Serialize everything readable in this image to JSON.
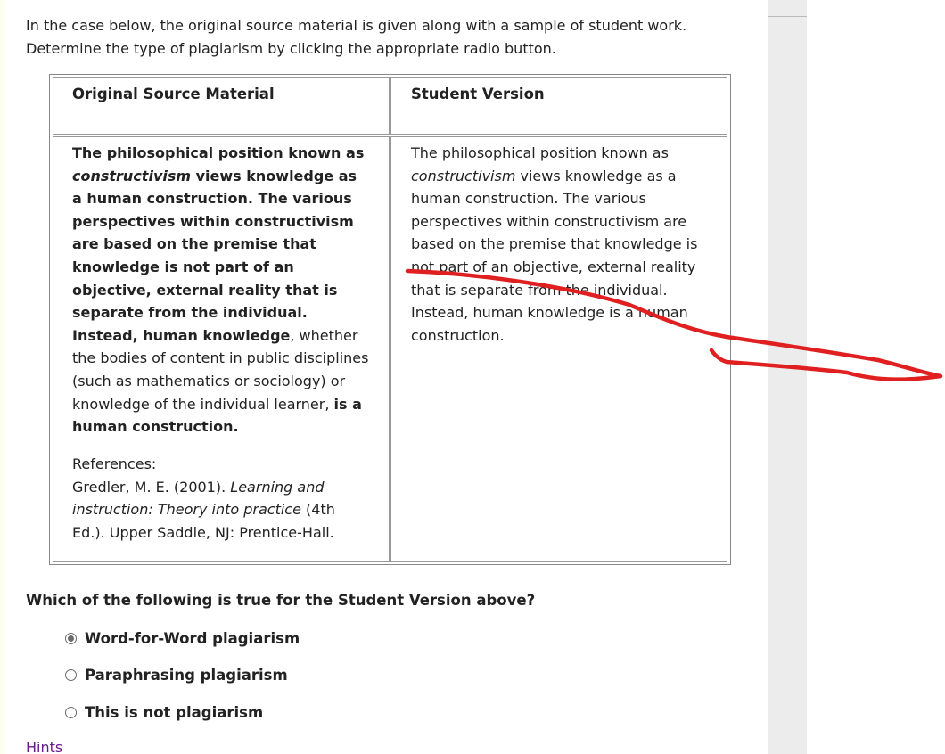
{
  "intro": {
    "line1": "In the case below, the original source material is given along with a sample of student work.",
    "line2": "Determine the type of plagiarism by clicking the appropriate radio button."
  },
  "table": {
    "original_header": "Original Source Material",
    "student_header": "Student Version",
    "original": {
      "lines": [
        {
          "segments": [
            {
              "text": "The philosophical position known as",
              "style": "bold"
            }
          ]
        },
        {
          "segments": [
            {
              "text": "constructivism",
              "style": "bold-italic"
            },
            {
              "text": " views knowledge as",
              "style": "bold"
            }
          ]
        },
        {
          "segments": [
            {
              "text": "a human construction. The various",
              "style": "bold"
            }
          ]
        },
        {
          "segments": [
            {
              "text": "perspectives within constructivism",
              "style": "bold"
            }
          ]
        },
        {
          "segments": [
            {
              "text": "are based on the premise that",
              "style": "bold"
            }
          ]
        },
        {
          "segments": [
            {
              "text": "knowledge is not part of an",
              "style": "bold"
            }
          ]
        },
        {
          "segments": [
            {
              "text": "objective, external reality that is",
              "style": "bold"
            }
          ]
        },
        {
          "segments": [
            {
              "text": "separate from the individual.",
              "style": "bold"
            }
          ]
        },
        {
          "segments": [
            {
              "text": "Instead, human knowledge",
              "style": "bold"
            },
            {
              "text": ", whether",
              "style": "normal"
            }
          ]
        },
        {
          "segments": [
            {
              "text": "the bodies of content in public disciplines",
              "style": "normal"
            }
          ]
        },
        {
          "segments": [
            {
              "text": "(such as mathematics or sociology) or",
              "style": "normal"
            }
          ]
        },
        {
          "segments": [
            {
              "text": "knowledge of the individual learner, ",
              "style": "normal"
            },
            {
              "text": "is a",
              "style": "bold"
            }
          ]
        },
        {
          "segments": [
            {
              "text": "human construction.",
              "style": "bold"
            }
          ]
        }
      ]
    },
    "references": {
      "label": "References:",
      "lines": [
        {
          "segments": [
            {
              "text": "Gredler, M. E. (2001). ",
              "style": "normal"
            },
            {
              "text": "Learning and",
              "style": "italic"
            }
          ]
        },
        {
          "segments": [
            {
              "text": "instruction: Theory into practice",
              "style": "italic"
            },
            {
              "text": " (4th",
              "style": "normal"
            }
          ]
        },
        {
          "segments": [
            {
              "text": "Ed.). Upper Saddle, NJ: Prentice-Hall.",
              "style": "normal"
            }
          ]
        }
      ]
    },
    "student": {
      "lines": [
        {
          "segments": [
            {
              "text": "The philosophical position known as",
              "style": "normal"
            }
          ]
        },
        {
          "segments": [
            {
              "text": "constructivism",
              "style": "italic"
            },
            {
              "text": " views knowledge as a",
              "style": "normal"
            }
          ]
        },
        {
          "segments": [
            {
              "text": "human construction. The various",
              "style": "normal"
            }
          ]
        },
        {
          "segments": [
            {
              "text": "perspectives within constructivism are",
              "style": "normal"
            }
          ]
        },
        {
          "segments": [
            {
              "text": "based on the premise that knowledge is",
              "style": "normal"
            }
          ]
        },
        {
          "segments": [
            {
              "text": "not part of an objective, external reality",
              "style": "normal"
            }
          ]
        },
        {
          "segments": [
            {
              "text": "that is separate from the individual.",
              "style": "normal"
            }
          ]
        },
        {
          "segments": [
            {
              "text": "Instead, human knowledge is a human",
              "style": "normal"
            }
          ]
        },
        {
          "segments": [
            {
              "text": "construction.",
              "style": "normal"
            }
          ]
        }
      ]
    }
  },
  "question": {
    "text": "Which of the following is true for the Student Version above?",
    "options": [
      {
        "label": "Word-for-Word plagiarism",
        "checked": true
      },
      {
        "label": "Paraphrasing plagiarism",
        "checked": false
      },
      {
        "label": "This is not plagiarism",
        "checked": false
      }
    ]
  },
  "hints_link": "Hints",
  "colors": {
    "annotation_stroke": "#e02020",
    "hints_link": "#6a1b8a",
    "side_panel": "#ececec"
  }
}
